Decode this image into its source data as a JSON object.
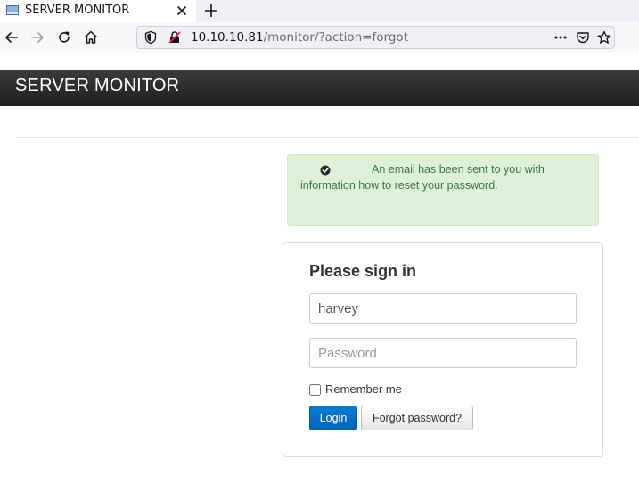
{
  "browser": {
    "tab": {
      "title": "SERVER MONITOR"
    },
    "url": {
      "host": "10.10.10.81",
      "path": "/monitor/?action=forgot"
    }
  },
  "site": {
    "brand": "SERVER MONITOR"
  },
  "alert": {
    "message": "An email has been sent to you with information how to reset your password."
  },
  "signin": {
    "title": "Please sign in",
    "username_value": "harvey",
    "password_placeholder": "Password",
    "remember_label": "Remember me",
    "login_label": "Login",
    "forgot_label": "Forgot password?"
  },
  "colors": {
    "alert_bg": "#dff0d8",
    "alert_text": "#3c763d",
    "primary_button": "#0068bc",
    "header_bg": "#2a2a2a"
  }
}
